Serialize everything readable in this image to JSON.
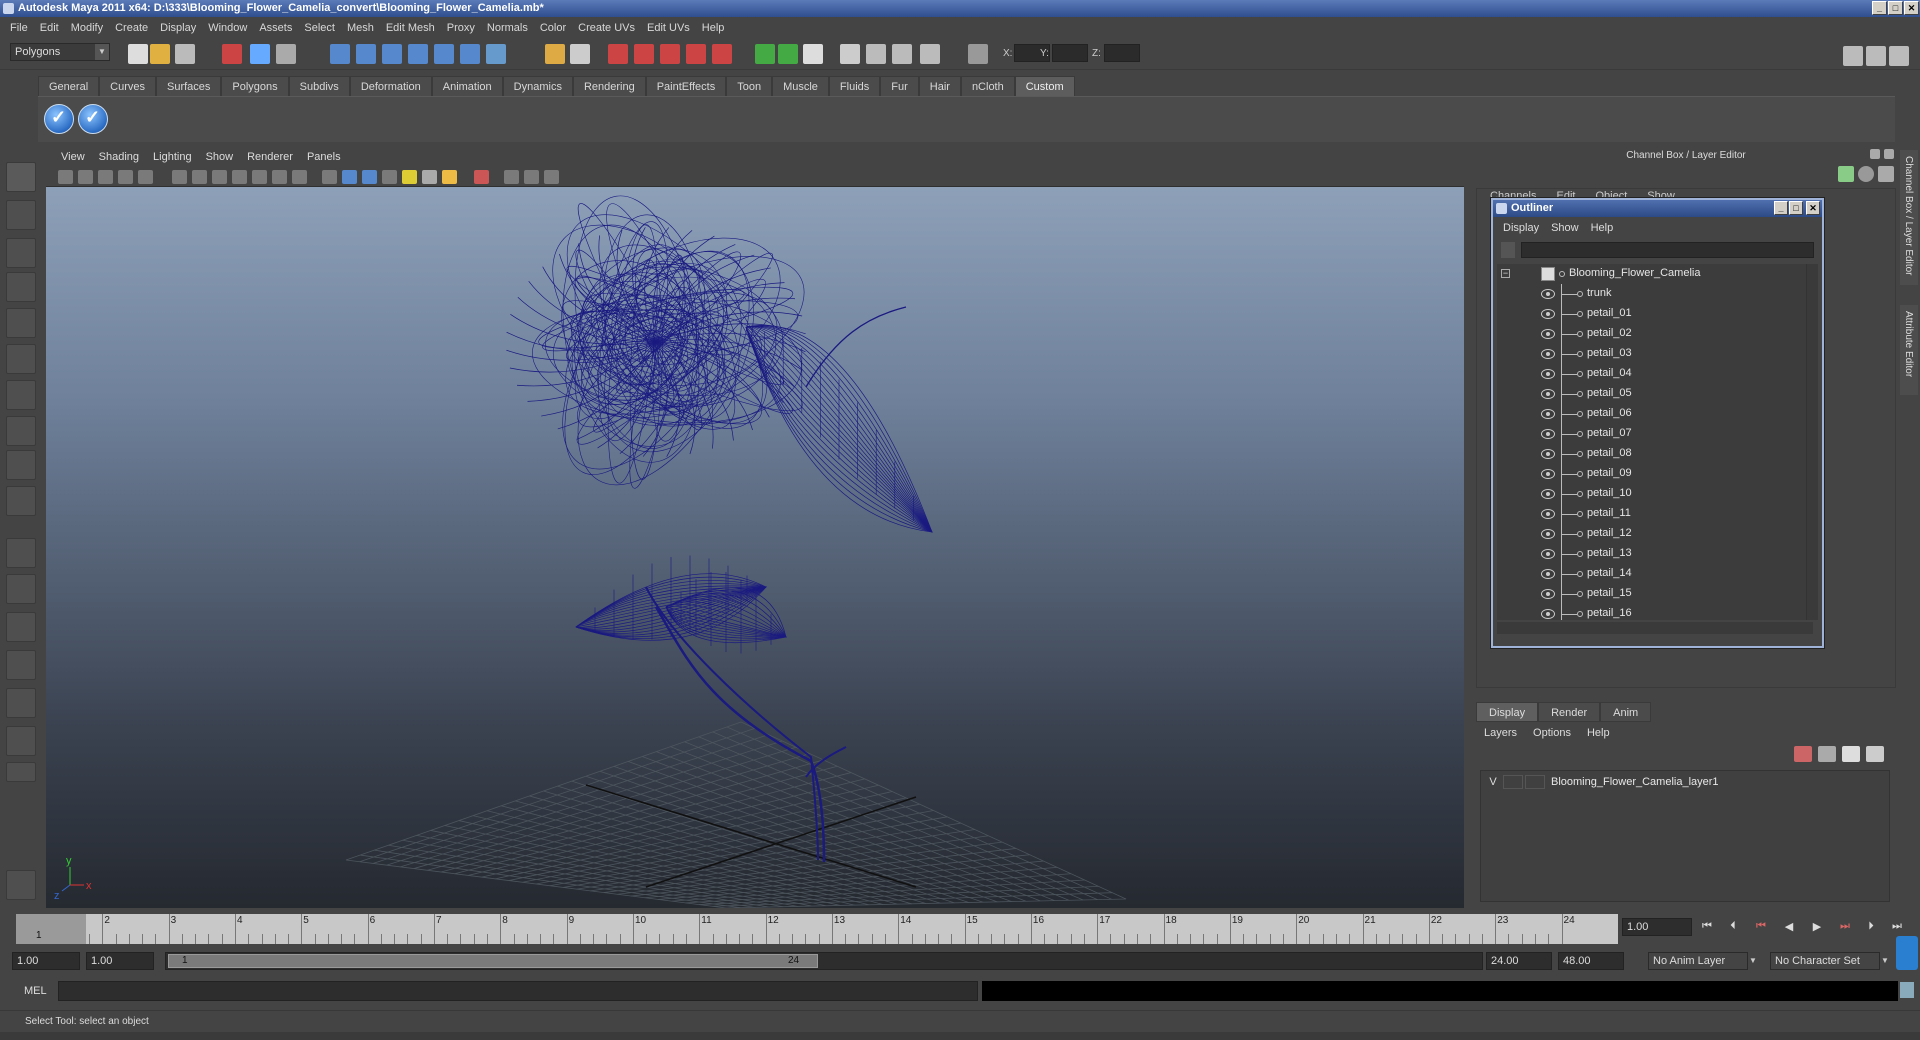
{
  "window": {
    "title": "Autodesk Maya 2011 x64: D:\\333\\Blooming_Flower_Camelia_convert\\Blooming_Flower_Camelia.mb*",
    "min": "_",
    "max": "□",
    "close": "✕"
  },
  "menubar": [
    "File",
    "Edit",
    "Modify",
    "Create",
    "Display",
    "Window",
    "Assets",
    "Select",
    "Mesh",
    "Edit Mesh",
    "Proxy",
    "Normals",
    "Color",
    "Create UVs",
    "Edit UVs",
    "Help"
  ],
  "statusline": {
    "mode": "Polygons",
    "x_label": "X:",
    "y_label": "Y:",
    "z_label": "Z:"
  },
  "shelf": {
    "tabs": [
      "General",
      "Curves",
      "Surfaces",
      "Polygons",
      "Subdivs",
      "Deformation",
      "Animation",
      "Dynamics",
      "Rendering",
      "PaintEffects",
      "Toon",
      "Muscle",
      "Fluids",
      "Fur",
      "Hair",
      "nCloth",
      "Custom"
    ],
    "active_tab": "Custom"
  },
  "viewport": {
    "menu": [
      "View",
      "Shading",
      "Lighting",
      "Show",
      "Renderer",
      "Panels"
    ],
    "axis_y": "y",
    "axis_x": "x",
    "axis_z": "z",
    "wire_color": "#1a1a80"
  },
  "channelbox": {
    "title": "Channel Box / Layer Editor",
    "menu": [
      "Channels",
      "Edit",
      "Object",
      "Show"
    ]
  },
  "outliner": {
    "title": "Outliner",
    "menu": [
      "Display",
      "Show",
      "Help"
    ],
    "root": "Blooming_Flower_Camelia",
    "children": [
      "trunk",
      "petail_01",
      "petail_02",
      "petail_03",
      "petail_04",
      "petail_05",
      "petail_06",
      "petail_07",
      "petail_08",
      "petail_09",
      "petail_10",
      "petail_11",
      "petail_12",
      "petail_13",
      "petail_14",
      "petail_15",
      "petail_16"
    ]
  },
  "layer_editor": {
    "tabs": [
      "Display",
      "Render",
      "Anim"
    ],
    "active_tab": "Display",
    "menu": [
      "Layers",
      "Options",
      "Help"
    ],
    "layer_visible": "V",
    "layer_name": "Blooming_Flower_Camelia_layer1"
  },
  "side_tabs": {
    "channel_box": "Channel Box / Layer Editor",
    "attribute_editor": "Attribute Editor"
  },
  "timeline": {
    "ticks": [
      "1",
      "2",
      "3",
      "4",
      "5",
      "6",
      "7",
      "8",
      "9",
      "10",
      "11",
      "12",
      "13",
      "14",
      "15",
      "16",
      "17",
      "18",
      "19",
      "20",
      "21",
      "22",
      "23",
      "24"
    ],
    "current_frame": "1",
    "current_field": "1.00"
  },
  "range": {
    "start_time": "1.00",
    "playback_start": "1.00",
    "range_start_label": "1",
    "range_end_label": "24",
    "playback_end": "24.00",
    "end_time": "48.00",
    "anim_layer": "No Anim Layer",
    "char_set": "No Character Set"
  },
  "cmdline": {
    "label": "MEL"
  },
  "helpline": {
    "text": "Select Tool: select an object"
  }
}
